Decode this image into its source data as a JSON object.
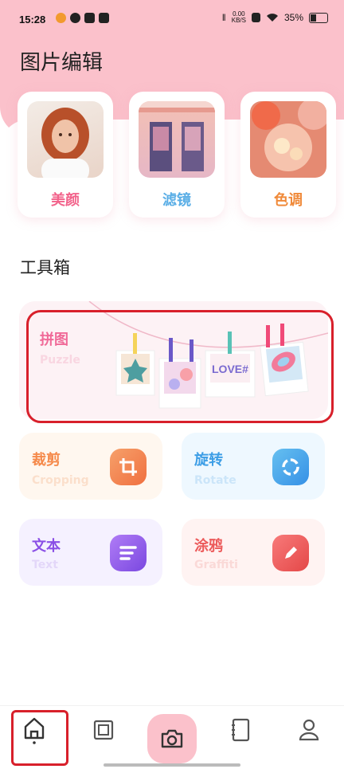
{
  "status_bar": {
    "time": "15:28",
    "net_speed_value": "0.00",
    "net_speed_unit": "KB/S",
    "battery": "35%"
  },
  "header": {
    "title": "图片编辑"
  },
  "features": [
    {
      "label": "美颜",
      "color": "#f2628a"
    },
    {
      "label": "滤镜",
      "color": "#5aaee6"
    },
    {
      "label": "色调",
      "color": "#f08a3a"
    }
  ],
  "toolbox": {
    "title": "工具箱",
    "puzzle": {
      "title": "拼图",
      "subtitle": "Puzzle",
      "sticker_text": "LOVE#"
    },
    "tools": [
      {
        "title": "裁剪",
        "subtitle": "Cropping",
        "color": "#f5894a",
        "bg": "#fff7ef",
        "icon": "crop-icon"
      },
      {
        "title": "旋转",
        "subtitle": "Rotate",
        "color": "#3d9ee6",
        "bg": "#eef8ff",
        "icon": "rotate-icon"
      },
      {
        "title": "文本",
        "subtitle": "Text",
        "color": "#8a4fe6",
        "bg": "#f5f1ff",
        "icon": "text-icon"
      },
      {
        "title": "涂鸦",
        "subtitle": "Graffiti",
        "color": "#ec5a5a",
        "bg": "#fff3f2",
        "icon": "pencil-icon"
      }
    ]
  },
  "bottom_nav": {
    "items": [
      "home-icon",
      "gallery-icon",
      "camera-icon",
      "notebook-icon",
      "profile-icon"
    ],
    "active": "home-icon"
  },
  "colors": {
    "accent_pink": "#fbc1cb",
    "highlight_red": "#d8202b"
  }
}
